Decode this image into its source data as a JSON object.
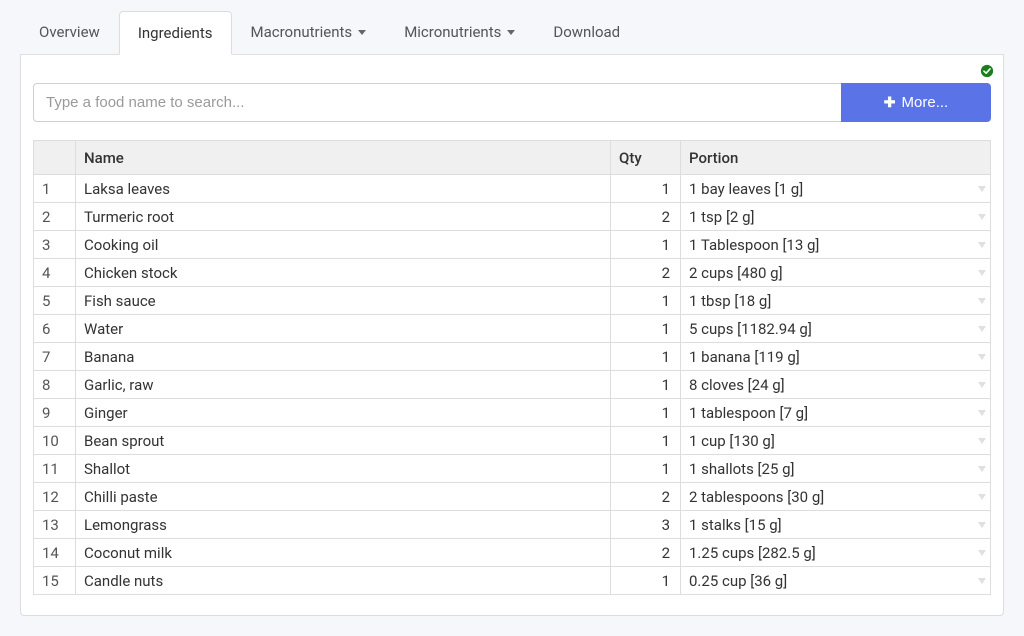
{
  "tabs": {
    "overview": "Overview",
    "ingredients": "Ingredients",
    "macronutrients": "Macronutrients",
    "micronutrients": "Micronutrients",
    "download": "Download"
  },
  "search": {
    "placeholder": "Type a food name to search...",
    "more_label": "More..."
  },
  "table": {
    "headers": {
      "name": "Name",
      "qty": "Qty",
      "portion": "Portion"
    },
    "rows": [
      {
        "idx": "1",
        "name": "Laksa leaves",
        "qty": "1",
        "portion": "1 bay leaves [1 g]"
      },
      {
        "idx": "2",
        "name": "Turmeric root",
        "qty": "2",
        "portion": "1 tsp [2 g]"
      },
      {
        "idx": "3",
        "name": "Cooking oil",
        "qty": "1",
        "portion": "1 Tablespoon [13 g]"
      },
      {
        "idx": "4",
        "name": "Chicken stock",
        "qty": "2",
        "portion": "2 cups [480 g]"
      },
      {
        "idx": "5",
        "name": "Fish sauce",
        "qty": "1",
        "portion": "1 tbsp [18 g]"
      },
      {
        "idx": "6",
        "name": "Water",
        "qty": "1",
        "portion": "5 cups [1182.94 g]"
      },
      {
        "idx": "7",
        "name": "Banana",
        "qty": "1",
        "portion": "1 banana [119 g]"
      },
      {
        "idx": "8",
        "name": "Garlic, raw",
        "qty": "1",
        "portion": "8 cloves [24 g]"
      },
      {
        "idx": "9",
        "name": "Ginger",
        "qty": "1",
        "portion": "1 tablespoon [7 g]"
      },
      {
        "idx": "10",
        "name": "Bean sprout",
        "qty": "1",
        "portion": "1 cup [130 g]"
      },
      {
        "idx": "11",
        "name": "Shallot",
        "qty": "1",
        "portion": "1 shallots [25 g]"
      },
      {
        "idx": "12",
        "name": "Chilli paste",
        "qty": "2",
        "portion": "2 tablespoons [30 g]"
      },
      {
        "idx": "13",
        "name": "Lemongrass",
        "qty": "3",
        "portion": "1 stalks [15 g]"
      },
      {
        "idx": "14",
        "name": "Coconut milk",
        "qty": "2",
        "portion": "1.25 cups [282.5 g]"
      },
      {
        "idx": "15",
        "name": "Candle nuts",
        "qty": "1",
        "portion": "0.25 cup [36 g]"
      }
    ]
  }
}
